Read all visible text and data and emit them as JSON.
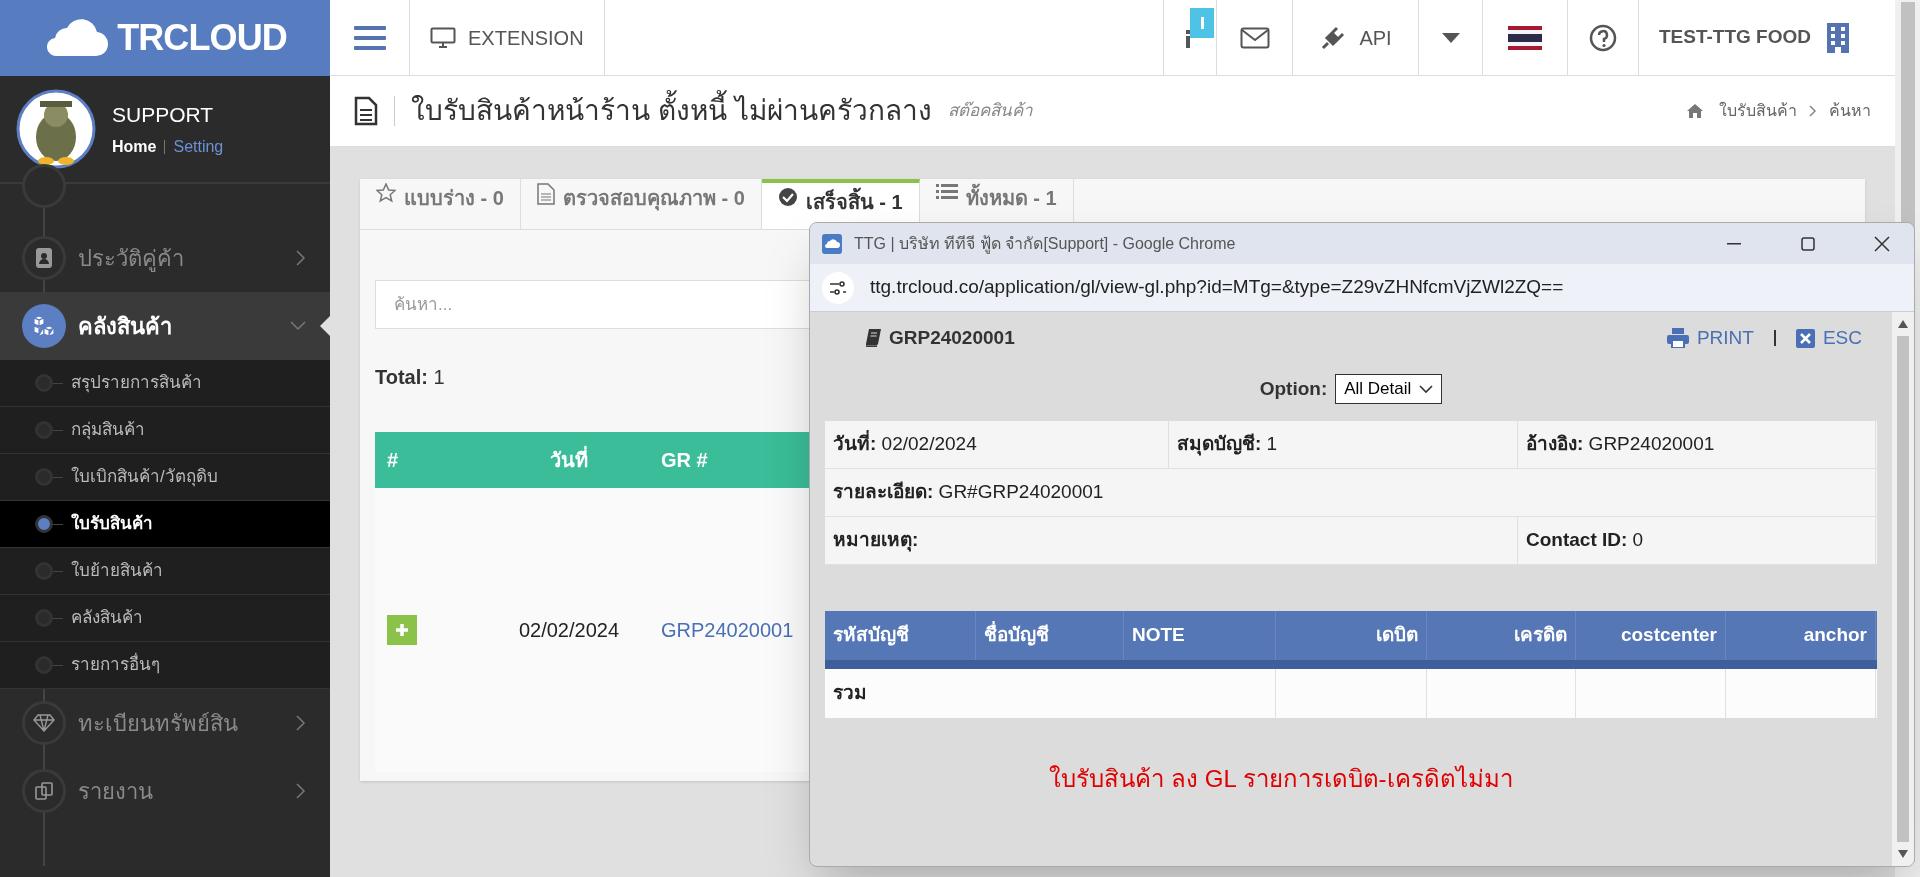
{
  "logo": {
    "text": "TRCLOUD"
  },
  "user": {
    "name": "SUPPORT",
    "links": [
      "Home",
      "Setting"
    ]
  },
  "topbar": {
    "extension": "EXTENSION",
    "api": "API",
    "company": "TEST-TTG FOOD"
  },
  "sidebar": {
    "items": [
      {
        "label": "ประวัติคู่ค้า",
        "selected": false,
        "expanded": false
      },
      {
        "label": "คลังสินค้า",
        "selected": true,
        "expanded": true,
        "children": [
          {
            "label": "สรุปรายการสินค้า",
            "selected": false
          },
          {
            "label": "กลุ่มสินค้า",
            "selected": false
          },
          {
            "label": "ใบเบิกสินค้า/วัตถุดิบ",
            "selected": false
          },
          {
            "label": "ใบรับสินค้า",
            "selected": true
          },
          {
            "label": "ใบย้ายสินค้า",
            "selected": false
          },
          {
            "label": "คลังสินค้า",
            "selected": false
          },
          {
            "label": "รายการอื่นๆ",
            "selected": false
          }
        ]
      },
      {
        "label": "ทะเบียนทรัพย์สิน",
        "selected": false,
        "expanded": false
      },
      {
        "label": "รายงาน",
        "selected": false,
        "expanded": false
      }
    ]
  },
  "page_header": {
    "title": "ใบรับสินค้าหน้าร้าน ตั้งหนี้ ไม่ผ่านครัวกลาง",
    "subtitle": "สต๊อคสินค้า",
    "breadcrumb": [
      "ใบรับสินค้า",
      "ค้นหา"
    ]
  },
  "tabs": [
    {
      "label": "แบบร่าง - 0",
      "selected": false
    },
    {
      "label": "ตรวจสอบคุณภาพ - 0",
      "selected": false
    },
    {
      "label": "เสร็จสิ้น - 1",
      "selected": true
    },
    {
      "label": "ทั้งหมด - 1",
      "selected": false
    }
  ],
  "search": {
    "placeholder": "ค้นหา..."
  },
  "total": {
    "label": "Total:",
    "value": "1"
  },
  "table": {
    "columns": [
      "#",
      "วันที่",
      "GR #"
    ],
    "rows": [
      {
        "date": "02/02/2024",
        "gr": "GRP24020001"
      }
    ]
  },
  "popup": {
    "window_title": "TTG | บริษัท ทีทีจี ฟู้ด จำกัด[Support] - Google Chrome",
    "url": "ttg.trcloud.co/application/gl/view-gl.php?id=MTg=&type=Z29vZHNfcmVjZWl2ZQ==",
    "doc_number": "GRP24020001",
    "actions": [
      "PRINT",
      "ESC"
    ],
    "option": {
      "label": "Option:",
      "value": "All Detail"
    },
    "info_rows": [
      [
        {
          "label": "วันที่:",
          "value": "02/02/2024"
        },
        {
          "label": "สมุดบัญชี:",
          "value": "1"
        },
        {
          "label": "อ้างอิง:",
          "value": "GRP24020001"
        }
      ],
      [
        {
          "label": "รายละเอียด:",
          "value": "GR#GRP24020001"
        }
      ],
      [
        {
          "label": "หมายเหตุ:"
        },
        {
          "label": "Contact ID:",
          "value": "0"
        }
      ]
    ],
    "gl_table": {
      "columns": [
        "รหัสบัญชี",
        "ชื่อบัญชี",
        "NOTE",
        "เดบิต",
        "เครดิต",
        "costcenter",
        "anchor"
      ],
      "total_label": "รวม"
    },
    "note": "ใบรับสินค้า ลง GL รายการเดบิต-เครดิตไม่มา"
  }
}
